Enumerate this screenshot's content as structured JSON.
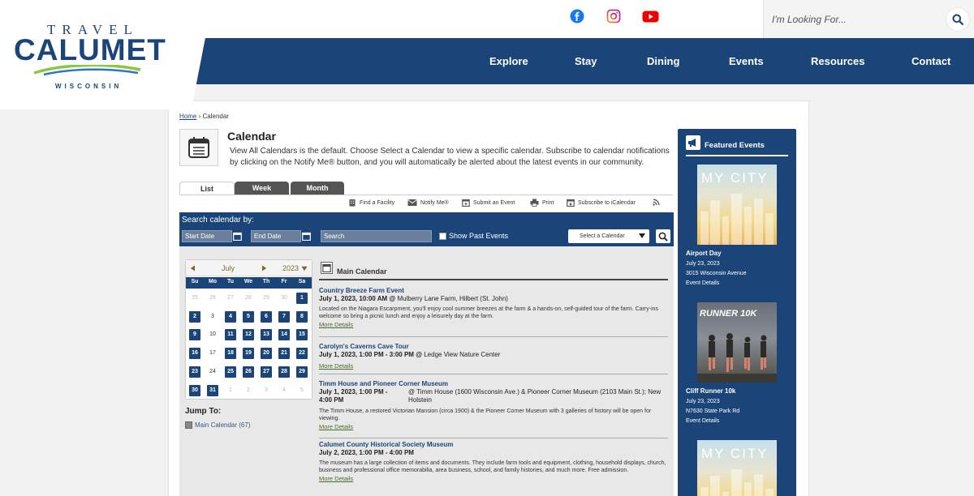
{
  "logo": {
    "line1": "TRAVEL",
    "line2": "CALUMET",
    "line3": "WISCONSIN"
  },
  "header": {
    "social": [
      "facebook-icon",
      "instagram-icon",
      "youtube-icon"
    ],
    "search_placeholder": "I'm Looking For..."
  },
  "nav": {
    "items": [
      "Explore",
      "Stay",
      "Dining",
      "Events",
      "Resources",
      "Contact"
    ]
  },
  "breadcrumb": {
    "home": "Home",
    "sep": "›",
    "current": "Calendar"
  },
  "page": {
    "title": "Calendar",
    "intro": "View All Calendars is the default. Choose Select a Calendar to view a specific calendar. Subscribe to calendar notifications by clicking on the Notify Me® button, and you will automatically be alerted about the latest events in our community."
  },
  "tabs": [
    "List",
    "Week",
    "Month"
  ],
  "toolbar": [
    "Find a Facility",
    "Notify Me®",
    "Submit an Event",
    "Print",
    "Subscribe to iCalendar"
  ],
  "search_bar": {
    "label": "Search calendar by:",
    "start_placeholder": "Start Date",
    "end_placeholder": "End Date",
    "search_placeholder": "Search",
    "show_past": "Show Past Events",
    "select_calendar": "Select a Calendar"
  },
  "minical": {
    "month": "July",
    "year": "2023",
    "dow": [
      "Su",
      "Mo",
      "Tu",
      "We",
      "Th",
      "Fr",
      "Sa"
    ],
    "weeks": [
      [
        {
          "d": "25",
          "s": "faded"
        },
        {
          "d": "26",
          "s": "faded"
        },
        {
          "d": "27",
          "s": "faded"
        },
        {
          "d": "28",
          "s": "faded"
        },
        {
          "d": "29",
          "s": "faded"
        },
        {
          "d": "30",
          "s": "faded"
        },
        {
          "d": "1",
          "s": "on"
        }
      ],
      [
        {
          "d": "2",
          "s": "on"
        },
        {
          "d": "3",
          "s": "plain"
        },
        {
          "d": "4",
          "s": "on"
        },
        {
          "d": "5",
          "s": "on"
        },
        {
          "d": "6",
          "s": "on"
        },
        {
          "d": "7",
          "s": "on"
        },
        {
          "d": "8",
          "s": "on"
        }
      ],
      [
        {
          "d": "9",
          "s": "on"
        },
        {
          "d": "10",
          "s": "plain"
        },
        {
          "d": "11",
          "s": "on"
        },
        {
          "d": "12",
          "s": "on"
        },
        {
          "d": "13",
          "s": "on"
        },
        {
          "d": "14",
          "s": "on"
        },
        {
          "d": "15",
          "s": "on"
        }
      ],
      [
        {
          "d": "16",
          "s": "on"
        },
        {
          "d": "17",
          "s": "plain"
        },
        {
          "d": "18",
          "s": "on"
        },
        {
          "d": "19",
          "s": "on"
        },
        {
          "d": "20",
          "s": "on"
        },
        {
          "d": "21",
          "s": "on"
        },
        {
          "d": "22",
          "s": "on"
        }
      ],
      [
        {
          "d": "23",
          "s": "on"
        },
        {
          "d": "24",
          "s": "plain"
        },
        {
          "d": "25",
          "s": "on"
        },
        {
          "d": "26",
          "s": "on"
        },
        {
          "d": "27",
          "s": "on"
        },
        {
          "d": "28",
          "s": "on"
        },
        {
          "d": "29",
          "s": "on"
        }
      ],
      [
        {
          "d": "30",
          "s": "on"
        },
        {
          "d": "31",
          "s": "on"
        },
        {
          "d": "1",
          "s": "faded"
        },
        {
          "d": "2",
          "s": "faded"
        },
        {
          "d": "3",
          "s": "faded"
        },
        {
          "d": "4",
          "s": "faded"
        },
        {
          "d": "5",
          "s": "faded"
        }
      ]
    ]
  },
  "jump": {
    "title": "Jump To:",
    "item": "Main Calendar (67)"
  },
  "main_calendar": {
    "title": "Main Calendar"
  },
  "events": [
    {
      "title": "Country Breeze Farm Event",
      "date": "July 1, 2023, 10:00 AM",
      "at": "@",
      "location": "Mulberry Lane Farm, Hilbert (St. John)",
      "desc": "Located on the Niagara Escarpment, you'll enjoy cool summer breezes at the farm & a hands-on, self-guided tour of the farm. Carry-ins welcome so bring a picnic lunch and enjoy a leisurely day at the farm.",
      "more": "More Details"
    },
    {
      "title": "Carolyn's Caverns Cave Tour",
      "date": "July 1, 2023, 1:00 PM - 3:00 PM",
      "at": "@",
      "location": "Ledge View Nature Center",
      "desc": "",
      "more": "More Details"
    },
    {
      "title": "Timm House and Pioneer Corner Museum",
      "date": "July 1, 2023, 1:00 PM - 4:00 PM",
      "at": "@",
      "location": "Timm House (1600 Wisconsin Ave.) & Pioneer Corner Museum (2103 Main St.); New Holstein",
      "desc": "The Timm House, a restored Victorian Mansion (circa 1900) & the Pioneer Corner Museum with 3 galleries of history will be open for viewing.",
      "more": "More Details"
    },
    {
      "title": "Calumet County Historical Society Museum",
      "date": "July 2, 2023, 1:00 PM - 4:00 PM",
      "at": "",
      "location": "",
      "desc": "The museum has a large collection of items and documents. They include farm tools and equipment, clothing, household displays, church, business and professional office memorabilia, area business, school, and family histories, and much more. Free admission.",
      "more": "More Details"
    }
  ],
  "featured": {
    "title": "Featured Events",
    "items": [
      {
        "img_text": "MY CITY",
        "name": "Airport Day",
        "date": "July 23, 2023",
        "address": "3015 Wisconsin Avenue",
        "link": "Event Details"
      },
      {
        "img_text": "RUNNER 10K",
        "name": "Cliff Runner 10k",
        "date": "July 23, 2023",
        "address": "N7630 State Park Rd",
        "link": "Event Details"
      },
      {
        "img_text": "MY CITY"
      }
    ]
  },
  "colors": {
    "brand_blue": "#1b4579",
    "link_green": "#4a6a2a"
  }
}
